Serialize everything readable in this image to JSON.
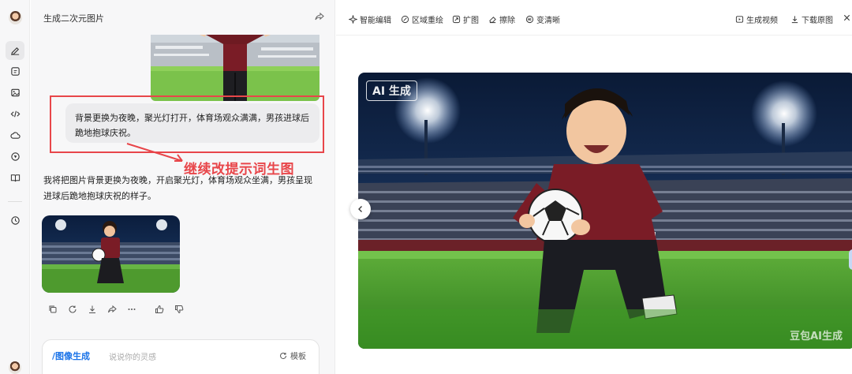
{
  "conversation": {
    "title": "生成二次元图片",
    "user_message": "背景更换为夜晚，聚光灯打开，体育场观众满满，男孩进球后跪地抱球庆祝。",
    "annotation": "继续改提示词生图",
    "assistant_reply": "我将把图片背景更换为夜晚，开启聚光灯，体育场观众坐满，男孩呈现进球后跪地抱球庆祝的样子。"
  },
  "input": {
    "command": "/图像生成",
    "placeholder": "说说你的灵感",
    "template_label": "模板"
  },
  "toolbar": {
    "smart_edit": "智能编辑",
    "region_redraw": "区域重绘",
    "expand": "扩图",
    "erase": "擦除",
    "sharpen": "变清晰",
    "gen_video": "生成视频",
    "download": "下载原图"
  },
  "image": {
    "badge": "AI 生成",
    "watermark": "豆包AI生成"
  },
  "colors": {
    "accent_red": "#e8464a",
    "link_blue": "#1a73e8"
  }
}
